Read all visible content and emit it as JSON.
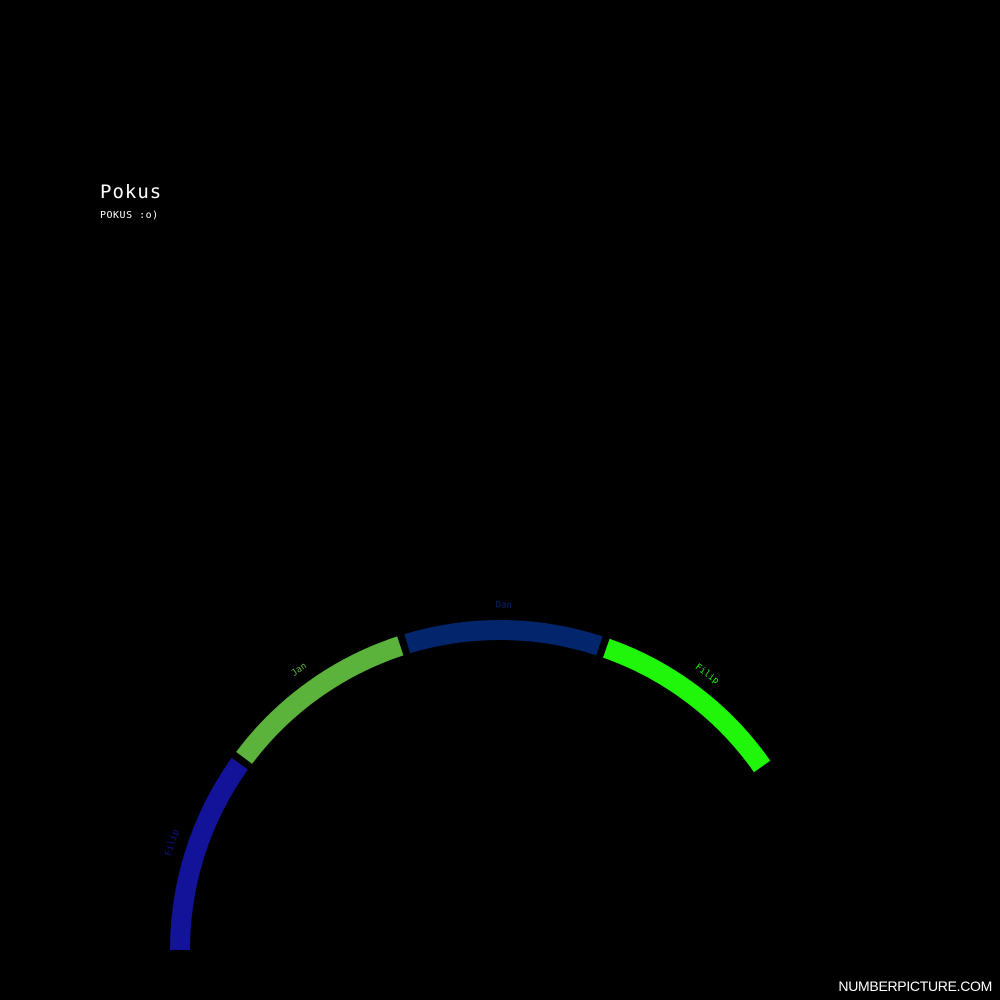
{
  "page": {
    "title": "Pokus",
    "subtitle": "POKUS :o)",
    "watermark": "NUMBERPICTURE.COM"
  },
  "chart_data": {
    "type": "pie",
    "title": "Pokus",
    "subtitle": "POKUS :o)",
    "style": "arc-ring",
    "slices": [
      {
        "label": "Filip",
        "value": 1,
        "color": "#13139a"
      },
      {
        "label": "Jan",
        "value": 1,
        "color": "#5bb33c"
      },
      {
        "label": "Dan",
        "value": 1,
        "color": "#03256c"
      },
      {
        "label": "Filip",
        "value": 1,
        "color": "#1ff60a"
      }
    ]
  }
}
